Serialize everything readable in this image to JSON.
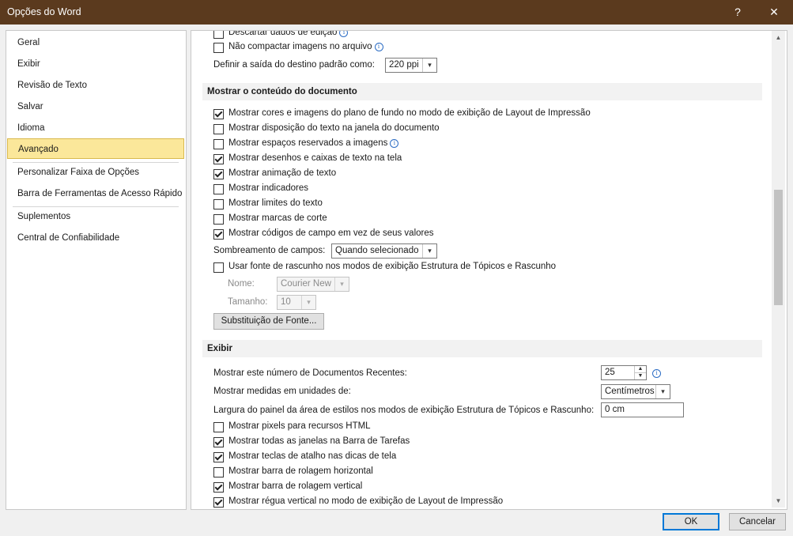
{
  "window": {
    "title": "Opções do Word",
    "help_label": "?",
    "close_label": "✕"
  },
  "sidebar": {
    "items": [
      {
        "label": "Geral"
      },
      {
        "label": "Exibir"
      },
      {
        "label": "Revisão de Texto"
      },
      {
        "label": "Salvar"
      },
      {
        "label": "Idioma"
      },
      {
        "label": "Avançado",
        "active": true
      },
      {
        "label": "Personalizar Faixa de Opções"
      },
      {
        "label": "Barra de Ferramentas de Acesso Rápido"
      },
      {
        "label": "Suplementos"
      },
      {
        "label": "Central de Confiabilidade"
      }
    ]
  },
  "top": {
    "discard_label": "Descartar dados de edição",
    "discard_checked": false,
    "no_compress_label": "Não compactar imagens no arquivo",
    "no_compress_checked": false,
    "default_output_label": "Definir a saída do destino padrão como:",
    "default_output_value": "220 ppi"
  },
  "show_content": {
    "header": "Mostrar o conteúdo do documento",
    "options": [
      {
        "label": "Mostrar cores e imagens do plano de fundo no modo de exibição de Layout de Impressão",
        "checked": true
      },
      {
        "label": "Mostrar disposição do texto na janela do documento",
        "checked": false
      },
      {
        "label": "Mostrar espaços reservados a imagens",
        "checked": false,
        "info": true
      },
      {
        "label": "Mostrar desenhos e caixas de texto na tela",
        "checked": true
      },
      {
        "label": "Mostrar animação de texto",
        "checked": true
      },
      {
        "label": "Mostrar indicadores",
        "checked": false
      },
      {
        "label": "Mostrar limites do texto",
        "checked": false
      },
      {
        "label": "Mostrar marcas de corte",
        "checked": false
      },
      {
        "label": "Mostrar códigos de campo em vez de seus valores",
        "checked": true
      }
    ],
    "field_shading_label": "Sombreamento de campos:",
    "field_shading_value": "Quando selecionado",
    "draft_font_label": "Usar fonte de rascunho nos modos de exibição Estrutura de Tópicos e Rascunho",
    "draft_font_checked": false,
    "name_label": "Nome:",
    "name_value": "Courier New",
    "size_label": "Tamanho:",
    "size_value": "10",
    "font_sub_button": "Substituição de Fonte..."
  },
  "display": {
    "header": "Exibir",
    "recent_docs_label": "Mostrar este número de Documentos Recentes:",
    "recent_docs_value": "25",
    "units_label": "Mostrar medidas em unidades de:",
    "units_value": "Centímetros",
    "style_pane_label": "Largura do painel da área de estilos nos modos de exibição Estrutura de Tópicos e Rascunho:",
    "style_pane_value": "0 cm",
    "options": [
      {
        "label": "Mostrar pixels para recursos HTML",
        "checked": false
      },
      {
        "label": "Mostrar todas as janelas na Barra de Tarefas",
        "checked": true
      },
      {
        "label": "Mostrar teclas de atalho nas dicas de tela",
        "checked": true
      },
      {
        "label": "Mostrar barra de rolagem horizontal",
        "checked": false
      },
      {
        "label": "Mostrar barra de rolagem vertical",
        "checked": true
      },
      {
        "label": "Mostrar régua vertical no modo de exibição de Layout de Impressão",
        "checked": true
      }
    ]
  },
  "footer": {
    "ok_label": "OK",
    "cancel_label": "Cancelar"
  },
  "colors": {
    "titlebar": "#5b3a1e",
    "active_nav": "#fbe79a",
    "accent": "#0078d7"
  }
}
